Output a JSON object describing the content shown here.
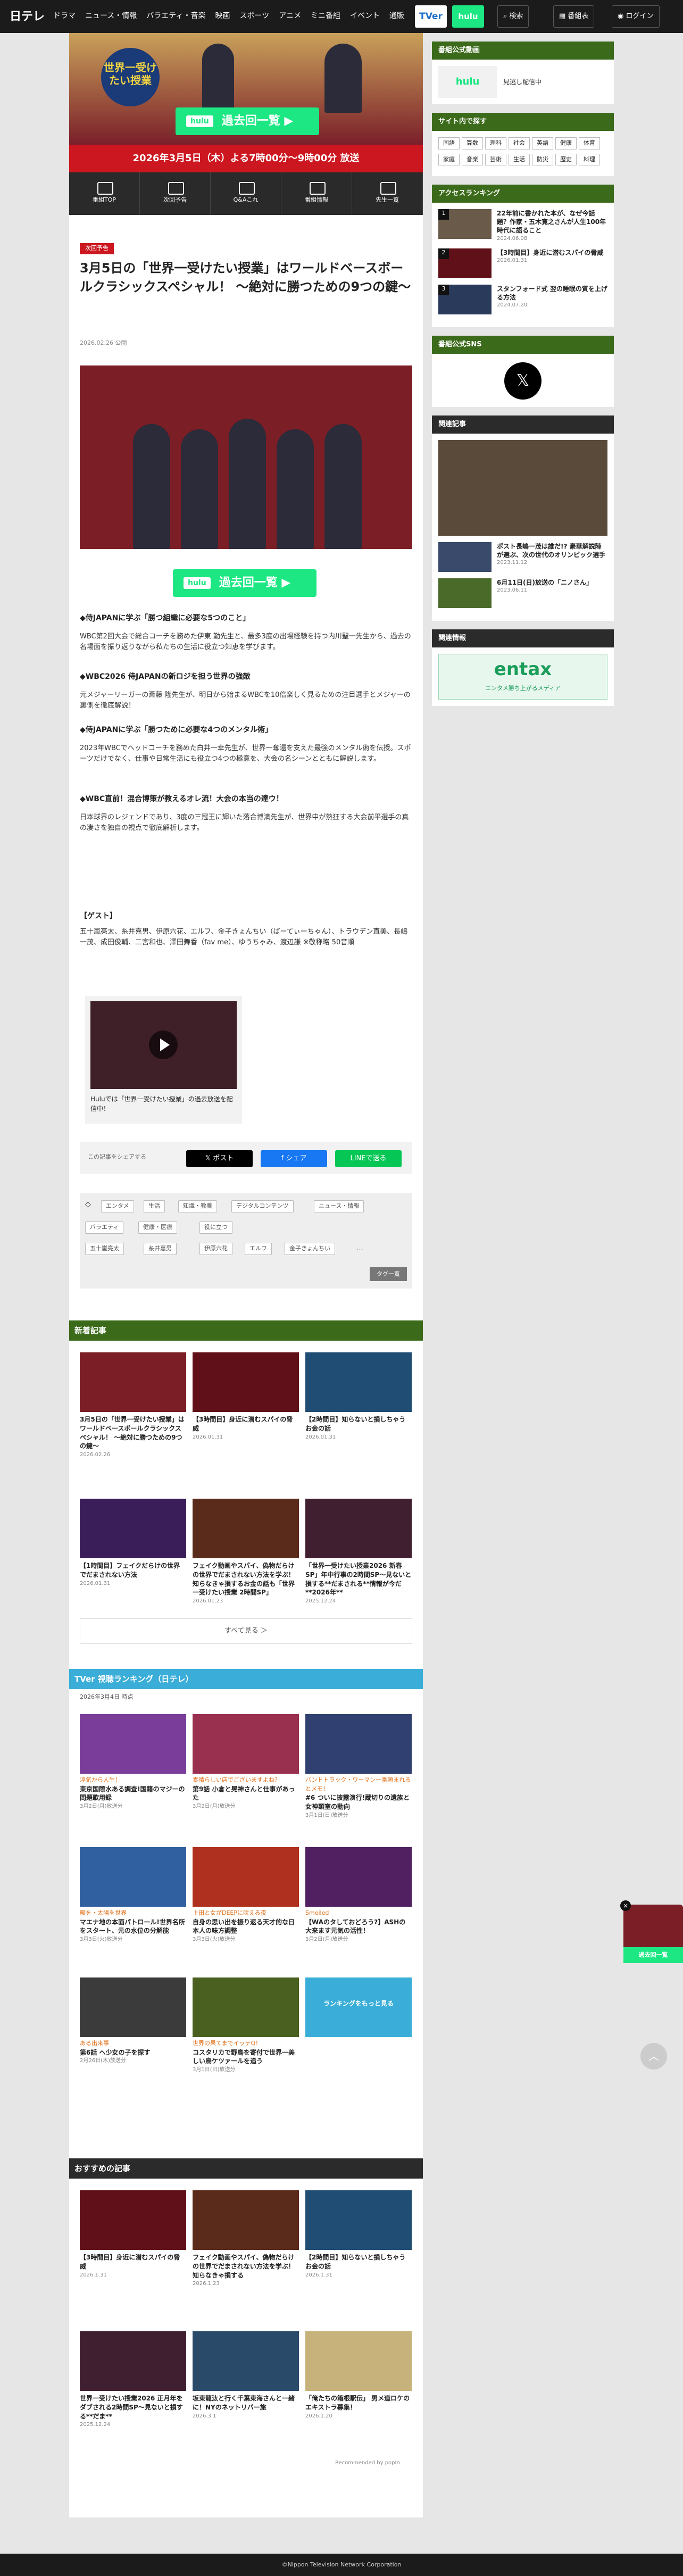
{
  "header": {
    "logo": "日テレ",
    "nav": [
      "ドラマ",
      "ニュース・情報",
      "バラエティ・音楽",
      "映画",
      "スポーツ",
      "アニメ",
      "ミニ番組",
      "イベント",
      "通販"
    ],
    "tver": "TVer",
    "hulu": "hulu",
    "search": "検索",
    "schedule": "番組表",
    "login": "ログイン"
  },
  "hero": {
    "logo": "世界一受けたい授業",
    "hulu_tag": "hulu",
    "button": "過去回一覧 ▶",
    "air": "2026年3月5日（木）よる7時00分〜9時00分 放送"
  },
  "program_nav": [
    "番組TOP",
    "次回予告",
    "Q&Aこれ",
    "番組情報",
    "先生一覧"
  ],
  "article": {
    "category": "次回予告",
    "title": "3月5日の「世界一受けたい授業」はワールドベースボールクラシックスペシャル！ ～絶対に勝つための9つの鍵～",
    "date": "2026.02.26 公開",
    "hulu_button": "過去回一覧 ▶",
    "sections": [
      {
        "h": "◆侍JAPANに学ぶ「勝つ組織に必要な5つのこと」",
        "p": "WBC第2回大会で総合コーチを務めた伊東 勤先生と、最多3度の出場経験を持つ内川聖一先生から、過去の名場面を振り返りながら私たちの生活に役立つ知恵を学びます。"
      },
      {
        "h": "◆WBC2026 侍JAPANの新ロジを担う世界の強敵",
        "p": "元メジャーリーガーの斎藤 隆先生が、明日から始まるWBCを10倍楽しく見るための注目選手とメジャーの裏側を徹底解説！"
      },
      {
        "h": "◆侍JAPANに学ぶ「勝つために必要な4つのメンタル術」",
        "p": "2023年WBCでヘッドコーチを務めた白井一幸先生が、世界一奪還を支えた最強のメンタル術を伝授。スポーツだけでなく、仕事や日常生活にも役立つ4つの極意を、大会の名シーンとともに解説します。"
      },
      {
        "h": "◆WBC直前！混合博策が教えるオレ流！大会の本当の達ウ！",
        "p": "日本球界のレジェンドであり、3度の三冠王に輝いた落合博満先生が、世界中が熱狂する大会前平選手の真の凄さを独自の視点で徹底解析します。"
      },
      {
        "h": "【ゲスト】",
        "p": "五十嵐亮太、糸井嘉男、伊原六花、エルフ、金子きょんちい（ばーてぃーちゃん）、トラウデン直美、長嶋一茂、成田俊輔、二宮和也、澤田舞香（fav me）、ゆうちゃみ、渡辺謙 ※敬称略 50音順"
      }
    ],
    "video_caption": "Huluでは「世界一受けたい授業」の過去放送を配信中！",
    "share_label": "この記事をシェアする",
    "share_x": "𝕏 ポスト",
    "share_fb": "f シェア",
    "share_line": "LINEで送る"
  },
  "tags": [
    "エンタメ",
    "生活",
    "知識・教養",
    "デジタルコンテンツ",
    "ニュース・情報",
    "バラエティ",
    "健康・医療",
    "役に立つ",
    "五十嵐亮太",
    "糸井嘉男",
    "伊原六花",
    "エルフ",
    "金子きょんちい"
  ],
  "tag_more": "タグ一覧",
  "new_articles": {
    "title": "新着記事",
    "items": [
      {
        "t": "3月5日の「世界一受けたい授業」はワールドベースボールクラシックスペシャル！ ～絶対に勝つための9つの鍵～",
        "d": "2026.02.26"
      },
      {
        "t": "【3時間目】身近に潜むスパイの脅威",
        "d": "2026.01.31"
      },
      {
        "t": "【2時間目】知らないと損しちゃうお金の話",
        "d": "2026.01.31"
      },
      {
        "t": "【1時間目】フェイクだらけの世界でだまされない方法",
        "d": "2026.01.31"
      },
      {
        "t": "フェイク動画やスパイ、偽物だらけの世界でだまされない方法を学ぶ！知らなきゃ損するお金の話も「世界一受けたい授業 2時間SP」",
        "d": "2026.01.23"
      },
      {
        "t": "「世界一受けたい授業2026 新春SP」年中行事の2時間SP～見ないと損する**だまされる**情報が今だ**2026年**",
        "d": "2025.12.24"
      }
    ],
    "more": "すべて見る ＞"
  },
  "ranking": {
    "title": "TVer 視聴ランキング（日テレ）",
    "note": "2026年3月4日 時点",
    "items": [
      {
        "c": "浮気から人生！",
        "t": "東京国際水ある調査!国籍のマジーの問題歌用録",
        "d": "3月2日(月)放送分"
      },
      {
        "c": "素晴らしい店でございますよね？",
        "t": "第9話 小倉と晃神さんと仕事があった",
        "d": "3月2日(月)放送分"
      },
      {
        "c": "バンドトラック・ワーマン一番頼まれるとメモ！",
        "t": "#6 ついに披露演行!蔵切りの遺族と女神類室の動向",
        "d": "3月1日(日)放送分"
      },
      {
        "c": "暖を・太陽を世界",
        "t": "マエナ地の本面パトロール!世界名所をスタート、元の水位の分解能",
        "d": "3月3日(火)放送分"
      },
      {
        "c": "上田と女がDEEPに吠える夜",
        "t": "自身の思い出を振り返る天才的な日本人の味方調整",
        "d": "3月3日(火)放送分"
      },
      {
        "c": "Smeiled",
        "t": "【WAのタしておどろう?】ASHの大来ます元気の活性！",
        "d": "3月2日(月)放送分"
      },
      {
        "c": "ある出来事",
        "t": "第6話 ヘ少女の子を探す",
        "d": "2月26日(木)放送分"
      },
      {
        "c": "世界の果てまでイッテQ！",
        "t": "コスタリカで野鳥を寄付で世界一美しい鳥ケツァールを追う",
        "d": "3月1日(日)放送分"
      },
      {
        "c": "",
        "t": "ランキングをもっと見る",
        "d": ""
      }
    ]
  },
  "recommended": {
    "title": "おすすめの記事",
    "items": [
      {
        "t": "【3時間目】身近に潜むスパイの脅威",
        "d": "2026.1.31"
      },
      {
        "t": "フェイク動画やスパイ、偽物だらけの世界でだまされない方法を学ぶ！知らなきゃ損する",
        "d": "2026.1.23"
      },
      {
        "t": "【2時間目】知らないと損しちゃうお金の話",
        "d": "2026.1.31"
      },
      {
        "t": "世界一受けたい授業2026 正月年をダブされる2時間SP～見ないと損する**だま**",
        "d": "2025.12.24"
      },
      {
        "t": "坂東龍汰と行く千葉東海さんと一緒に！NYのネットリバー旅",
        "d": "2026.3.1"
      },
      {
        "t": "「俺たちの箱根駅伝」 男メ道ロケのエキストラ募集！",
        "d": "2026.1.20"
      }
    ],
    "powered": "Recommended by popIn"
  },
  "sidebar": {
    "sns_title": "番組公式動画",
    "hulu": "hulu",
    "hulu_text": "見逃し配信中",
    "search_title": "サイト内で探す",
    "search_tags": [
      "国語",
      "算数",
      "理科",
      "社会",
      "英語",
      "健康",
      "体育",
      "家庭",
      "音楽",
      "芸術",
      "生活",
      "防災",
      "歴史",
      "料理"
    ],
    "access_title": "アクセスランキング",
    "access": [
      {
        "t": "22年前に書かれた本が、なぜ今話題？作家・五木寛之さんが人生100年時代に語ること",
        "d": "2024.06.08"
      },
      {
        "t": "【3時間目】身近に潜むスパイの脅威",
        "d": "2026.01.31"
      },
      {
        "t": "スタンフォード式 翌の睡眠の質を上げる方法",
        "d": "2024.07.20"
      }
    ],
    "official_sns": "番組公式SNS",
    "related_title": "関連記事",
    "related": [
      {
        "t": "ポスト長嶋一茂は誰だ!? 豪華解説陣が選ぶ、次の世代のオリンピック選手",
        "d": "2023.11.12"
      },
      {
        "t": "6月11日(日)放送の「ニノさん」",
        "d": "2023.06.11"
      }
    ],
    "ad_title": "関連情報",
    "ad_text": "entax",
    "ad_caption": "エンタメ勝ち上がるメディア"
  },
  "float": {
    "label": "過去回一覧",
    "hulu": "hulu"
  },
  "footer": "©Nippon Television Network Corporation"
}
